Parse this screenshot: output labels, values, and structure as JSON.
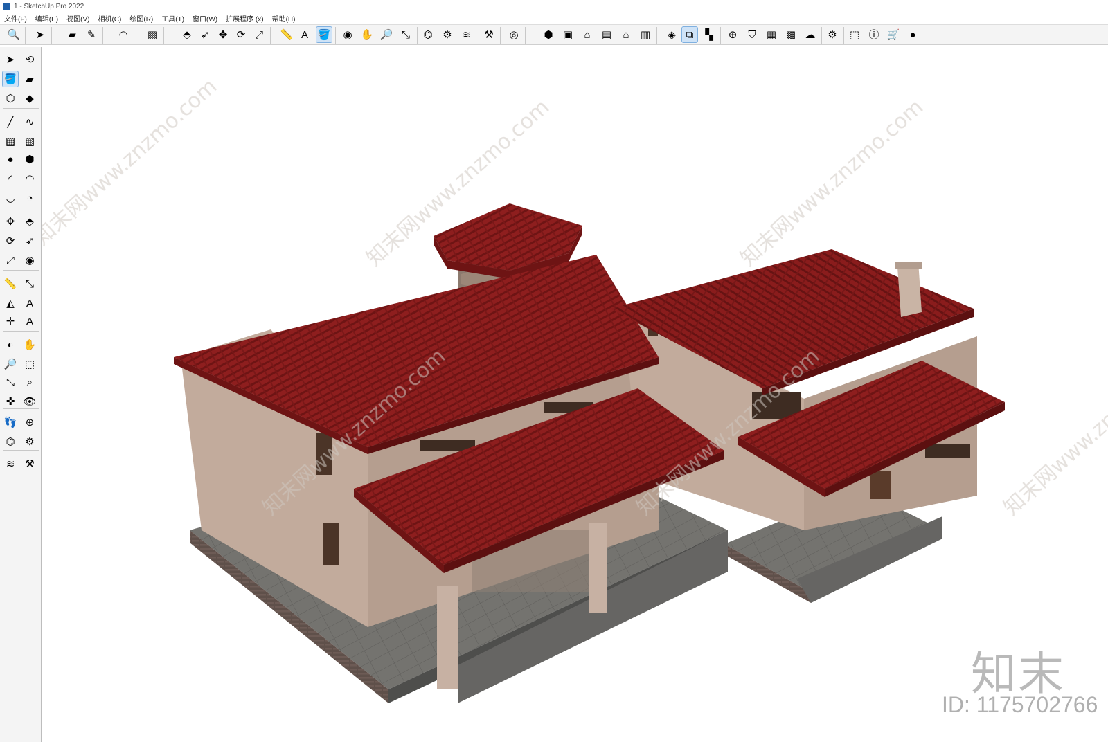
{
  "window": {
    "title": "1 - SketchUp Pro 2022"
  },
  "menu": [
    "文件(F)",
    "编辑(E)",
    "视图(V)",
    "相机(C)",
    "绘图(R)",
    "工具(T)",
    "窗口(W)",
    "扩展程序 (x)",
    "帮助(H)"
  ],
  "colors": {
    "roof": "#8e1e1e",
    "roof_dark": "#6e1414",
    "wall": "#c2ab9c",
    "wall_shade": "#a8907f",
    "floor": "#6f6e6c",
    "brick": "#5a4a45",
    "toolbar_bg": "#f4f4f4",
    "accent": "#1f5fa8"
  },
  "top_toolbar": [
    {
      "name": "search-icon",
      "glyph": "🔍",
      "active": false
    },
    {
      "name": "select-icon",
      "glyph": "➤",
      "active": false
    },
    {
      "name": "eraser-icon",
      "glyph": "▰",
      "active": false
    },
    {
      "name": "pencil-icon",
      "glyph": "✎",
      "active": false
    },
    {
      "name": "arc-icon",
      "glyph": "◠",
      "active": false
    },
    {
      "name": "rectangle-icon",
      "glyph": "▨",
      "active": false
    },
    {
      "name": "push-pull-icon",
      "glyph": "⬘",
      "active": false
    },
    {
      "name": "follow-me-icon",
      "glyph": "➶",
      "active": false
    },
    {
      "name": "move-icon",
      "glyph": "✥",
      "active": false
    },
    {
      "name": "rotate-icon",
      "glyph": "⟳",
      "active": false
    },
    {
      "name": "scale-icon",
      "glyph": "⤢",
      "active": false
    },
    {
      "name": "tape-measure-icon",
      "glyph": "📏",
      "active": false
    },
    {
      "name": "text-icon",
      "glyph": "A",
      "active": false
    },
    {
      "name": "paint-bucket-icon",
      "glyph": "🪣",
      "active": true
    },
    {
      "name": "orbit-icon",
      "glyph": "◉",
      "active": false
    },
    {
      "name": "pan-icon",
      "glyph": "✋",
      "active": false
    },
    {
      "name": "zoom-icon",
      "glyph": "🔎",
      "active": false
    },
    {
      "name": "zoom-extents-icon",
      "glyph": "⤡",
      "active": false
    },
    {
      "name": "warehouse-icon",
      "glyph": "⌬",
      "active": false
    },
    {
      "name": "extension-warehouse-icon",
      "glyph": "⚙",
      "active": false
    },
    {
      "name": "layers-icon",
      "glyph": "≋",
      "active": false
    },
    {
      "name": "extension-manager-icon",
      "glyph": "⚒",
      "active": false
    },
    {
      "name": "account-icon",
      "glyph": "◎",
      "active": false
    },
    {
      "name": "iso-view-icon",
      "glyph": "⬢",
      "active": false
    },
    {
      "name": "top-view-icon",
      "glyph": "▣",
      "active": false
    },
    {
      "name": "front-view-icon",
      "glyph": "⌂",
      "active": false
    },
    {
      "name": "right-view-icon",
      "glyph": "▤",
      "active": false
    },
    {
      "name": "back-view-icon",
      "glyph": "⌂",
      "active": false
    },
    {
      "name": "left-view-icon",
      "glyph": "▥",
      "active": false
    },
    {
      "name": "style-icon",
      "glyph": "◈",
      "active": false
    },
    {
      "name": "section-plane-icon",
      "glyph": "⧉",
      "active": true
    },
    {
      "name": "section-display-icon",
      "glyph": "▚",
      "active": false
    },
    {
      "name": "add-location-icon",
      "glyph": "⊕",
      "active": false
    },
    {
      "name": "shadows-icon",
      "glyph": "⛉",
      "active": false
    },
    {
      "name": "fog-icon",
      "glyph": "▦",
      "active": false
    },
    {
      "name": "terrain-icon",
      "glyph": "▩",
      "active": false
    },
    {
      "name": "cloud-icon",
      "glyph": "☁",
      "active": false
    },
    {
      "name": "settings-icon",
      "glyph": "⚙",
      "active": false
    },
    {
      "name": "components-icon",
      "glyph": "⬚",
      "active": false
    },
    {
      "name": "info-icon",
      "glyph": "ⓘ",
      "active": false
    },
    {
      "name": "cart-icon",
      "glyph": "🛒",
      "active": false
    },
    {
      "name": "user-icon",
      "glyph": "●",
      "active": false
    }
  ],
  "left_toolbar": [
    {
      "name": "select-icon",
      "glyph": "➤",
      "active": false
    },
    {
      "name": "orbit-icon",
      "glyph": "⟲",
      "active": false
    },
    {
      "name": "paint-bucket-icon",
      "glyph": "🪣",
      "active": true
    },
    {
      "name": "eraser-icon",
      "glyph": "▰",
      "active": false
    },
    {
      "name": "make-component-icon",
      "glyph": "⬡",
      "active": false
    },
    {
      "name": "tag-icon",
      "glyph": "◆",
      "active": false
    },
    {
      "name": "line-icon",
      "glyph": "╱",
      "active": false
    },
    {
      "name": "freehand-icon",
      "glyph": "∿",
      "active": false
    },
    {
      "name": "rectangle-icon",
      "glyph": "▨",
      "active": false
    },
    {
      "name": "rotated-rectangle-icon",
      "glyph": "▧",
      "active": false
    },
    {
      "name": "circle-icon",
      "glyph": "●",
      "active": false
    },
    {
      "name": "polygon-icon",
      "glyph": "⬢",
      "active": false
    },
    {
      "name": "arc-icon",
      "glyph": "◜",
      "active": false
    },
    {
      "name": "two-point-arc-icon",
      "glyph": "◠",
      "active": false
    },
    {
      "name": "three-point-arc-icon",
      "glyph": "◡",
      "active": false
    },
    {
      "name": "pie-icon",
      "glyph": "◔",
      "active": false
    },
    {
      "name": "move-icon",
      "glyph": "✥",
      "active": false
    },
    {
      "name": "push-pull-icon",
      "glyph": "⬘",
      "active": false
    },
    {
      "name": "rotate-icon",
      "glyph": "⟳",
      "active": false
    },
    {
      "name": "follow-me-icon",
      "glyph": "➶",
      "active": false
    },
    {
      "name": "scale-icon",
      "glyph": "⤢",
      "active": false
    },
    {
      "name": "offset-icon",
      "glyph": "◉",
      "active": false
    },
    {
      "name": "tape-measure-icon",
      "glyph": "📏",
      "active": false
    },
    {
      "name": "dimension-icon",
      "glyph": "⤡",
      "active": false
    },
    {
      "name": "protractor-icon",
      "glyph": "◭",
      "active": false
    },
    {
      "name": "text-icon",
      "glyph": "A",
      "active": false
    },
    {
      "name": "axes-icon",
      "glyph": "✛",
      "active": false
    },
    {
      "name": "3d-text-icon",
      "glyph": "A",
      "active": false
    },
    {
      "name": "orbit-tool-icon",
      "glyph": "◐",
      "active": false
    },
    {
      "name": "pan-icon",
      "glyph": "✋",
      "active": false
    },
    {
      "name": "zoom-icon",
      "glyph": "🔎",
      "active": false
    },
    {
      "name": "zoom-window-icon",
      "glyph": "⬚",
      "active": false
    },
    {
      "name": "zoom-extents-icon",
      "glyph": "⤡",
      "active": false
    },
    {
      "name": "previous-view-icon",
      "glyph": "⌕",
      "active": false
    },
    {
      "name": "position-camera-icon",
      "glyph": "✜",
      "active": false
    },
    {
      "name": "look-around-icon",
      "glyph": "👁",
      "active": false
    },
    {
      "name": "walk-icon",
      "glyph": "👣",
      "active": false
    },
    {
      "name": "section-plane-icon",
      "glyph": "⊕",
      "active": false
    },
    {
      "name": "warehouse-icon",
      "glyph": "⌬",
      "active": false
    },
    {
      "name": "extension-warehouse-icon",
      "glyph": "⚙",
      "active": false
    },
    {
      "name": "layers-icon",
      "glyph": "≋",
      "active": false
    },
    {
      "name": "extension-manager-icon",
      "glyph": "⚒",
      "active": false
    }
  ],
  "watermark": {
    "logo": "知末",
    "id": "ID: 1175702766",
    "site": "知末网www.znzmo.com"
  }
}
